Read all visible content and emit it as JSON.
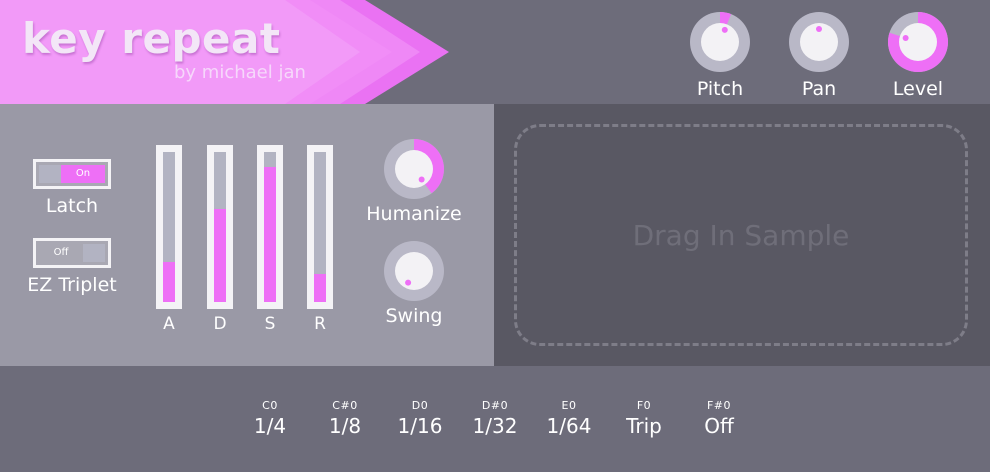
{
  "header": {
    "title": "key repeat",
    "subtitle": "by michael jan"
  },
  "colors": {
    "accent": "#ee6ff6",
    "panel": "#9a99a6",
    "dark_panel": "#595863",
    "header": "#6d6c7a"
  },
  "knobs": {
    "pitch": {
      "label": "Pitch",
      "level": 0.06
    },
    "pan": {
      "label": "Pan",
      "level": 0.0
    },
    "level": {
      "label": "Level",
      "level": 0.8
    }
  },
  "controls": {
    "latch": {
      "label": "Latch",
      "state": "On"
    },
    "ez_triplet": {
      "label": "EZ Triplet",
      "state": "Off"
    },
    "adsr": [
      {
        "label": "A",
        "level": 0.27
      },
      {
        "label": "D",
        "level": 0.62
      },
      {
        "label": "S",
        "level": 0.9
      },
      {
        "label": "R",
        "level": 0.19
      }
    ],
    "humanize": {
      "label": "Humanize",
      "level": 0.4
    },
    "swing": {
      "label": "Swing",
      "level": 0.0
    }
  },
  "sample": {
    "drop_text": "Drag In Sample"
  },
  "keys": [
    {
      "note": "C0",
      "value": "1/4"
    },
    {
      "note": "C#0",
      "value": "1/8"
    },
    {
      "note": "D0",
      "value": "1/16"
    },
    {
      "note": "D#0",
      "value": "1/32"
    },
    {
      "note": "E0",
      "value": "1/64"
    },
    {
      "note": "F0",
      "value": "Trip"
    },
    {
      "note": "F#0",
      "value": "Off"
    }
  ]
}
